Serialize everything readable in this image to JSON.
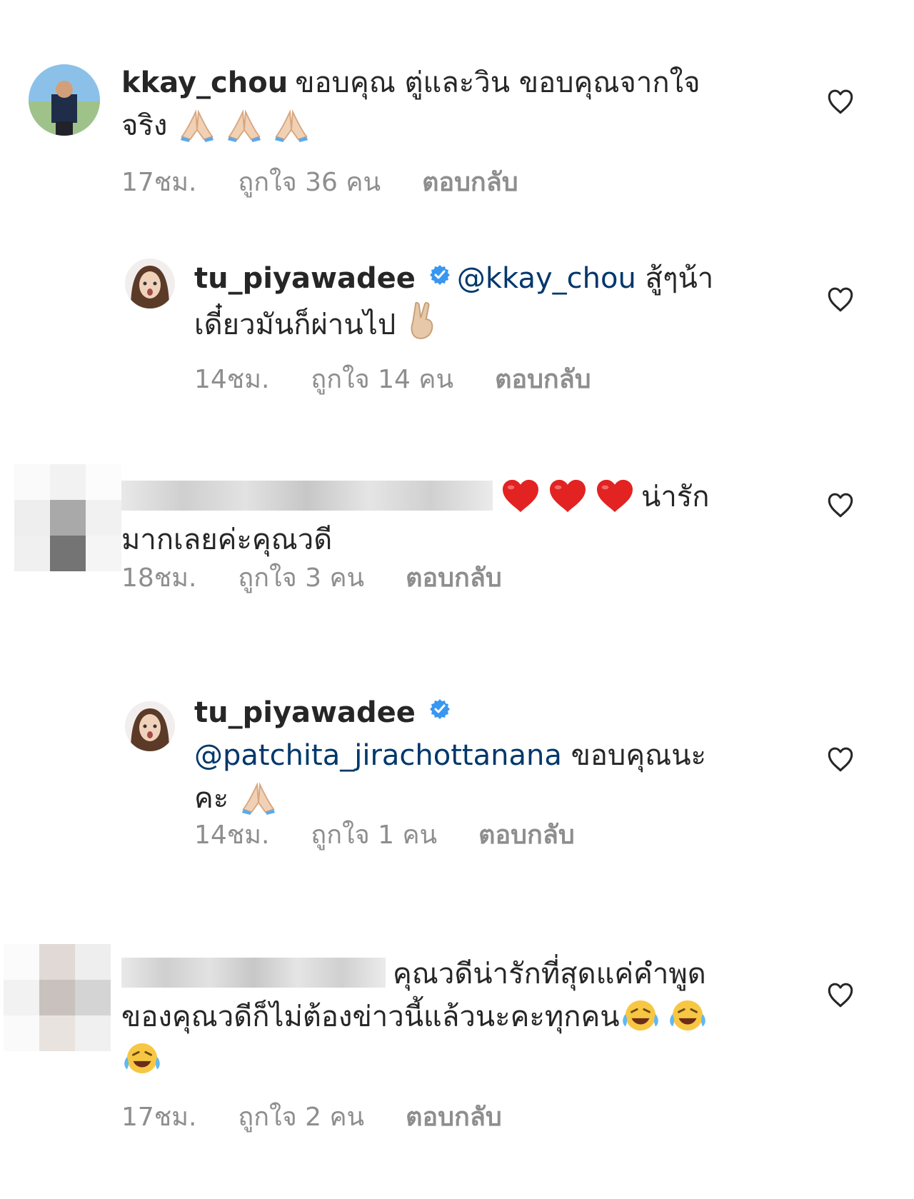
{
  "comments": [
    {
      "username": "kkay_chou",
      "text_line1": "ขอบคุณ ตู่และวิน ขอบคุณจากใจ",
      "text_line2": "จริง",
      "time": "17ชม.",
      "likes": "ถูกใจ 36 คน",
      "reply": "ตอบกลับ",
      "emoji": [
        "folded-hands",
        "folded-hands",
        "folded-hands"
      ]
    },
    {
      "username": "tu_piyawadee",
      "mention": "@kkay_chou",
      "text_line1": "สู้ๆน้า",
      "text_line2": "เดี๋ยวมันก็ผ่านไป",
      "time": "14ชม.",
      "likes": "ถูกใจ 14 คน",
      "reply": "ตอบกลับ",
      "emoji": [
        "victory-hand"
      ]
    },
    {
      "text_line1": "น่ารัก",
      "text_line2": "มากเลยค่ะคุณวดี",
      "time": "18ชม.",
      "likes": "ถูกใจ 3 คน",
      "reply": "ตอบกลับ",
      "emoji": [
        "red-heart",
        "red-heart",
        "red-heart"
      ]
    },
    {
      "username": "tu_piyawadee",
      "mention": "@patchita_jirachottanana",
      "text_line1": "ขอบคุณนะ",
      "text_line2": "คะ",
      "time": "14ชม.",
      "likes": "ถูกใจ 1 คน",
      "reply": "ตอบกลับ",
      "emoji": [
        "folded-hands"
      ]
    },
    {
      "text_line1": "คุณวดีน่ารักที่สุดแค่คำพูด",
      "text_line2": "ของคุณวดีก็ไม่ต้องข่าวนี้แล้วนะคะทุกคน",
      "time": "17ชม.",
      "likes": "ถูกใจ 2 คน",
      "reply": "ตอบกลับ",
      "emoji": [
        "joy-face",
        "joy-face",
        "joy-face"
      ]
    }
  ],
  "colors": {
    "text": "#262626",
    "meta": "#8e8e8e",
    "mention": "#00376b",
    "verified": "#3897f0"
  }
}
